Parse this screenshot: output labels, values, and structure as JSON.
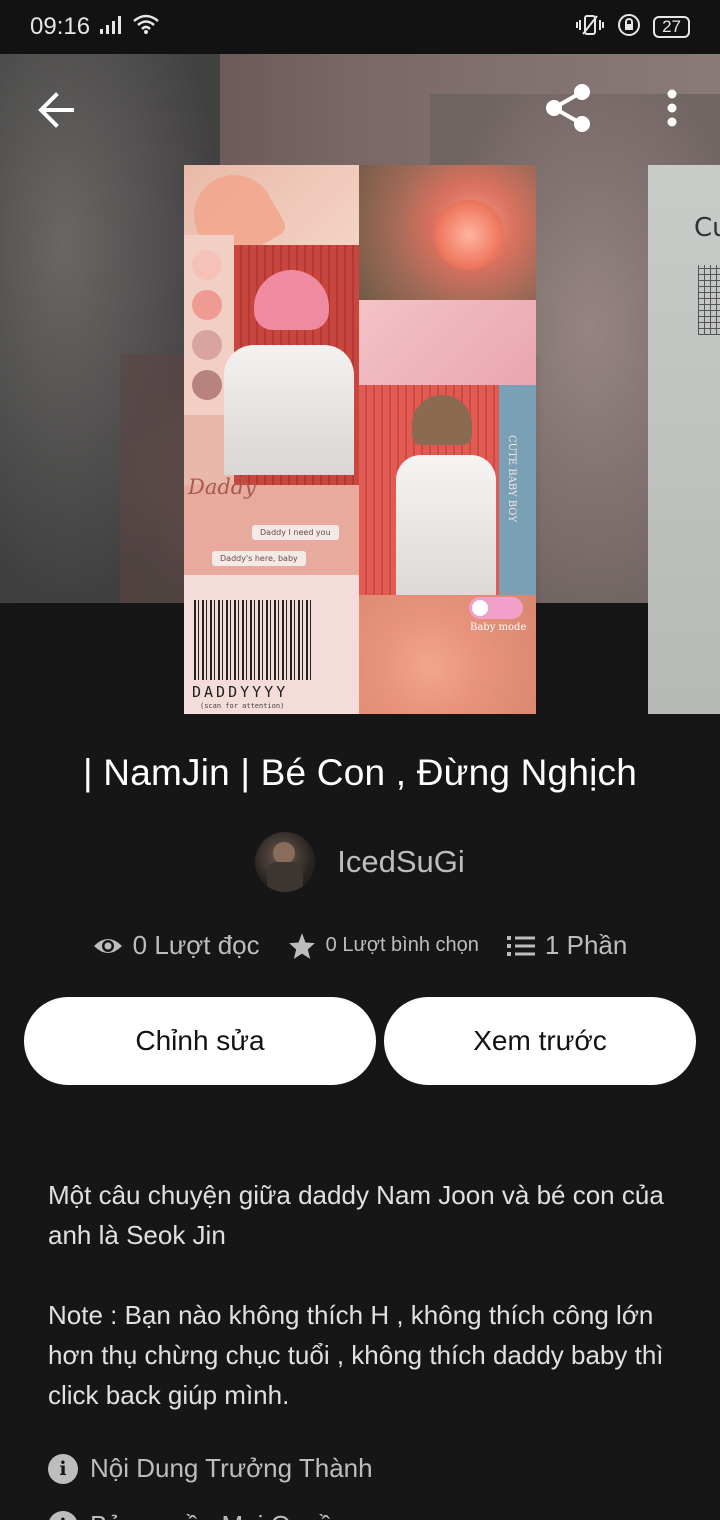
{
  "status_bar": {
    "time": "09:16",
    "battery": "27"
  },
  "header": {
    "back_icon": "arrow-left-icon",
    "share_icon": "share-icon",
    "more_icon": "more-vertical-icon"
  },
  "cover": {
    "text_daddy": "Daddy",
    "note_1": "Daddy I need you",
    "note_2": "Daddy's here, baby",
    "barcode_text": "DADDYYYY",
    "barcode_sub": "(scan for attention)",
    "side_text": "CUTE BABY BOY",
    "baby_mode": "Baby mode",
    "next_cover_text": "Cu"
  },
  "story": {
    "title": "| NamJin | Bé Con , Đừng Nghịch",
    "author": "IcedSuGi"
  },
  "stats": {
    "reads": "0 Lượt đọc",
    "votes": "0 Lượt bình chọn",
    "parts": "1 Phần"
  },
  "actions": {
    "edit": "Chỉnh sửa",
    "preview": "Xem trước"
  },
  "description": {
    "p1": "Một câu chuyện giữa daddy Nam Joon và bé con của anh là Seok Jin",
    "p2": "Note : Bạn nào không thích H , không thích công lớn hơn thụ chừng chục tuổi , không thích daddy baby thì click back giúp mình."
  },
  "tags": {
    "mature": "Nội Dung Trưởng Thành",
    "copyright": "Bản quyền Mọi Quyền"
  },
  "colors": {
    "background": "#161616",
    "button_bg": "#ffffff",
    "secondary_text": "#bdbdbd"
  }
}
